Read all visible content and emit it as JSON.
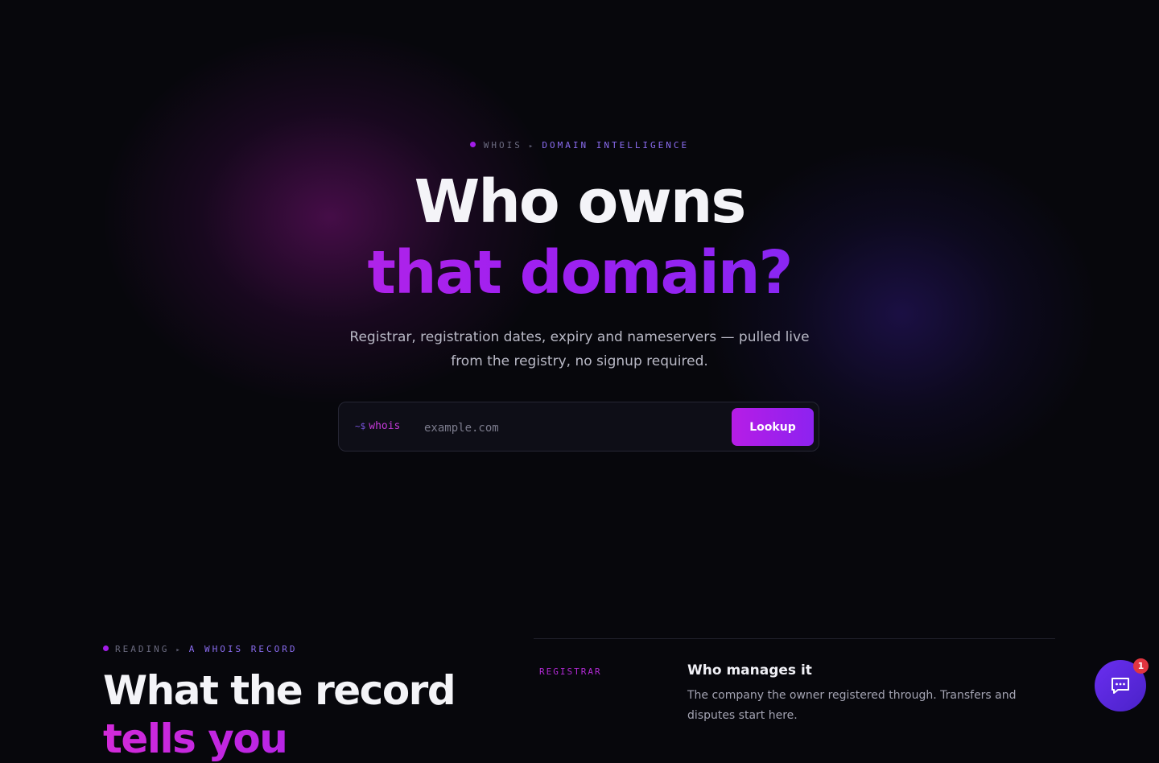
{
  "hero": {
    "kicker": {
      "label": "WHOIS",
      "accent": "DOMAIN INTELLIGENCE"
    },
    "title_line1": "Who owns",
    "title_line2": "that domain?",
    "subtitle": "Registrar, registration dates, expiry and nameservers — pulled live from the registry, no signup required."
  },
  "search": {
    "prompt_tilde": "~$",
    "prompt_cmd": "whois",
    "placeholder": "example.com",
    "button_label": "Lookup"
  },
  "section": {
    "kicker": {
      "label": "READING",
      "accent": "A WHOIS RECORD"
    },
    "title_line1": "What the record",
    "title_line2": "tells you",
    "field": {
      "label": "REGISTRAR",
      "title": "Who manages it",
      "description": "The company the owner registered through. Transfers and disputes start here."
    }
  },
  "chat": {
    "icon": "chat-bubble-icon",
    "badge_count": "1"
  },
  "colors": {
    "background": "#07070c",
    "accent_magenta": "#c43ad8",
    "accent_violet": "#6a2ef5",
    "badge": "#e0353f"
  }
}
